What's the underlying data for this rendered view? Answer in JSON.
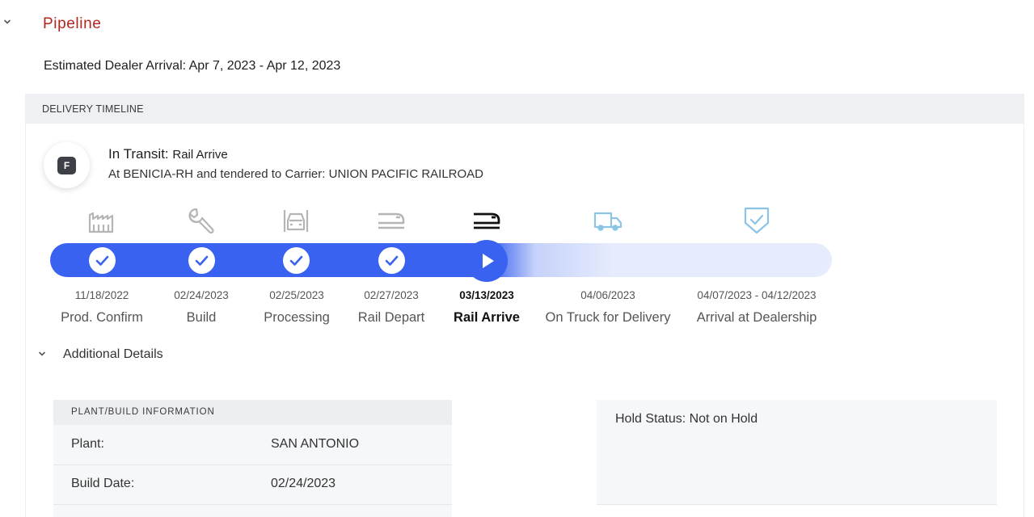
{
  "pipeline": {
    "title": "Pipeline",
    "estimated_arrival": "Estimated Dealer Arrival: Apr 7, 2023 - Apr 12, 2023"
  },
  "timeline": {
    "header": "DELIVERY TIMELINE",
    "avatar_letter": "F",
    "status_label": "In Transit:",
    "status_value": "Rail Arrive",
    "status_detail": "At BENICIA-RH and tendered to Carrier: UNION PACIFIC RAILROAD",
    "progress_completed_stages": 4,
    "current_stage": "Rail Arrive",
    "colors": {
      "accent": "#3a62f0",
      "track_inactive": "#e7ecfd",
      "brand_red": "#b3261e",
      "icon_done": "#b5b5b5",
      "icon_current": "#111111",
      "icon_future": "#8cc4e6"
    },
    "stages": [
      {
        "date": "11/18/2022",
        "label": "Prod. Confirm",
        "icon": "factory-icon",
        "status": "completed"
      },
      {
        "date": "02/24/2023",
        "label": "Build",
        "icon": "wrench-icon",
        "status": "completed"
      },
      {
        "date": "02/25/2023",
        "label": "Processing",
        "icon": "car-front-icon",
        "status": "completed"
      },
      {
        "date": "02/27/2023",
        "label": "Rail Depart",
        "icon": "train-icon",
        "status": "completed"
      },
      {
        "date": "03/13/2023",
        "label": "Rail Arrive",
        "icon": "train-icon",
        "status": "current"
      },
      {
        "date": "04/06/2023",
        "label": "On Truck for Delivery",
        "icon": "truck-icon",
        "status": "upcoming"
      },
      {
        "date": "04/07/2023 - 04/12/2023",
        "label": "Arrival at Dealership",
        "icon": "shield-check-icon",
        "status": "upcoming"
      }
    ]
  },
  "details": {
    "toggle_label": "Additional Details",
    "plant_panel": {
      "title": "PLANT/BUILD INFORMATION",
      "rows": [
        {
          "label": "Plant:",
          "value": "SAN ANTONIO"
        },
        {
          "label": "Build Date:",
          "value": "02/24/2023"
        }
      ]
    },
    "hold_status": "Hold Status: Not on Hold"
  }
}
